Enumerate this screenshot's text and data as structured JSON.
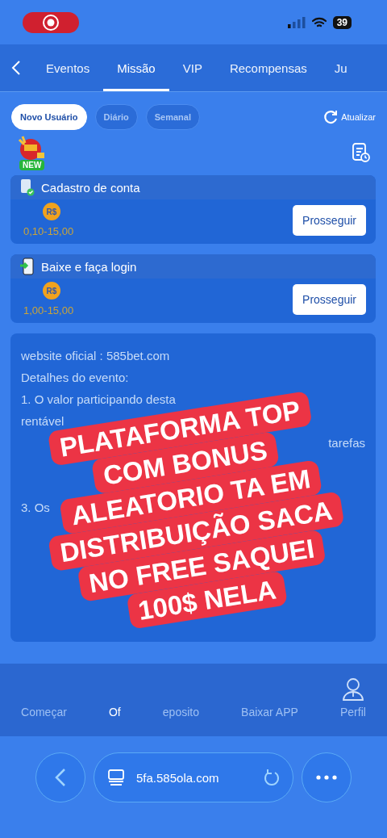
{
  "status_bar": {
    "recording": true,
    "battery": "39"
  },
  "tabs": [
    {
      "label": "Eventos",
      "selected": false
    },
    {
      "label": "Missão",
      "selected": true
    },
    {
      "label": "VIP",
      "selected": false
    },
    {
      "label": "Recompensas",
      "selected": false
    },
    {
      "label": "Ju",
      "selected": false
    }
  ],
  "filters": [
    {
      "label": "Novo Usuário",
      "selected": true
    },
    {
      "label": "Diário",
      "selected": false
    },
    {
      "label": "Semanal",
      "selected": false
    }
  ],
  "refresh_label": "Atualizar",
  "new_badge": "NEW",
  "tasks": [
    {
      "kind": "register",
      "title": "Cadastro de conta",
      "currency": "R$",
      "range": "0,10-15,00",
      "button": "Prosseguir"
    },
    {
      "kind": "download",
      "title": "Baixe e faça login",
      "currency": "R$",
      "range": "1,00-15,00",
      "button": "Prosseguir"
    }
  ],
  "description": [
    {
      "kind": "line",
      "text": "website oficial : 585bet.com"
    },
    {
      "kind": "line",
      "text": "Detalhes do evento:"
    },
    {
      "kind": "line",
      "text": "1. O valor participando desta"
    },
    {
      "kind": "line",
      "text": "rentável"
    },
    {
      "kind": "right",
      "text": "tarefas"
    },
    {
      "kind": "para",
      "text": "3. Os"
    }
  ],
  "bottom_nav": [
    {
      "label": "Começar",
      "selected": false
    },
    {
      "label": "Of",
      "selected": true
    },
    {
      "label": "eposito",
      "selected": false
    },
    {
      "label": "Baixar APP",
      "selected": false
    },
    {
      "label": "Perfil",
      "selected": false
    }
  ],
  "caption": [
    "PLATAFORMA TOP",
    "COM BONUS",
    "ALEATORIO TA EM",
    "DISTRIBUIÇÃO SACA",
    "NO FREE SAQUEI",
    "100$ NELA"
  ],
  "browser": {
    "url": "5fa.585ola.com"
  }
}
